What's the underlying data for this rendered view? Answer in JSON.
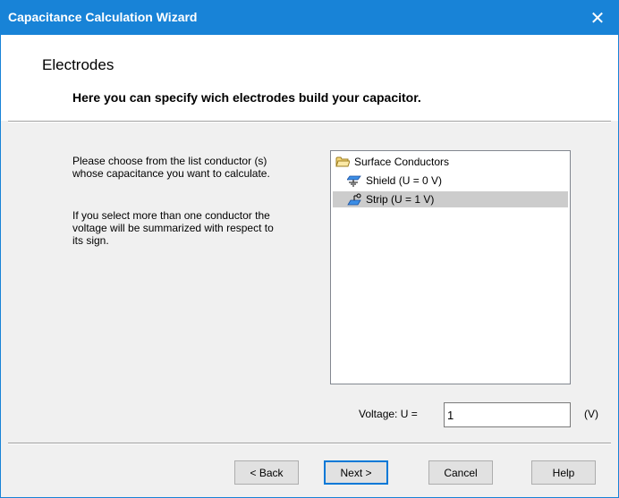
{
  "window": {
    "title": "Capacitance Calculation Wizard",
    "close_glyph": "✕"
  },
  "header": {
    "title": "Electrodes",
    "subtitle": "Here you can specify wich electrodes build your capacitor."
  },
  "description": {
    "line1": "Please choose from the list conductor (s)",
    "line2": "whose capacitance you want to calculate.",
    "line3": "If you select more than one conductor the",
    "line4": "voltage will be summarized with respect to",
    "line5": "its sign."
  },
  "tree": {
    "root": {
      "label": "Surface Conductors",
      "icon": "folder-icon"
    },
    "items": [
      {
        "label": "Shield (U = 0 V)",
        "icon": "ground-conductor-icon",
        "selected": false
      },
      {
        "label": "Strip (U = 1 V)",
        "icon": "strip-conductor-icon",
        "selected": true
      }
    ]
  },
  "voltage": {
    "label": "Voltage: U =",
    "value": "1",
    "unit": "(V)"
  },
  "buttons": {
    "back": "< Back",
    "next": "Next >",
    "cancel": "Cancel",
    "help": "Help"
  },
  "colors": {
    "titlebar": "#1883d7",
    "selection": "#cccccc",
    "accent": "#0078d7"
  }
}
